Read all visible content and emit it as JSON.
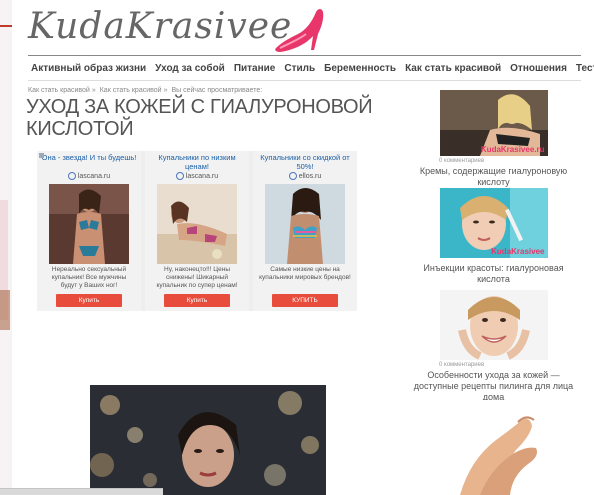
{
  "logo": {
    "text": "KudaKrasivee"
  },
  "nav": {
    "items": [
      "Активный образ жизни",
      "Уход за собой",
      "Питание",
      "Стиль",
      "Беременность",
      "Как стать красивой",
      "Отношения",
      "Тесты"
    ]
  },
  "breadcrumb": {
    "items": [
      "Как стать красивой",
      "Как стать красивой",
      "Вы сейчас просматриваете:"
    ],
    "separator": "»"
  },
  "article": {
    "title": "УХОД ЗА КОЖЕЙ С ГИАЛУРОНОВОЙ КИСЛОТОЙ"
  },
  "ads": [
    {
      "title": "Она - звезда! И ты будешь!",
      "domain": "lascana.ru",
      "description": "Нереально сексуальный купальник! Все мужчины будут у Ваших ног!",
      "button": "Купить"
    },
    {
      "title": "Купальники по низким ценам!",
      "domain": "lascana.ru",
      "description": "Ну, наконецто!!! Цены снижены! Шикарный купальник по супер ценам!",
      "button": "Купить"
    },
    {
      "title": "Купальники со скидкой от 50%!",
      "domain": "ellos.ru",
      "description": "Самые низкие цены на купальники мировых брендов!",
      "button": "КУПИТЬ"
    }
  ],
  "sidebar": [
    {
      "comments": "0 комментариев",
      "title": "Кремы, содержащие гиалуроновую кислоту",
      "watermark": "KudaKrasivee.ru"
    },
    {
      "comments": "",
      "title": "Инъекции красоты: гиалуроновая кислота",
      "watermark": "KudaKrasivee"
    },
    {
      "comments": "0 комментариев",
      "title": "Особенности ухода за кожей — доступные рецепты пилинга для лица дома",
      "watermark": ""
    }
  ],
  "colors": {
    "accent_red": "#e84c3d",
    "ad_link_blue": "#1a5fa8",
    "shoe_pink": "#e8356a"
  }
}
